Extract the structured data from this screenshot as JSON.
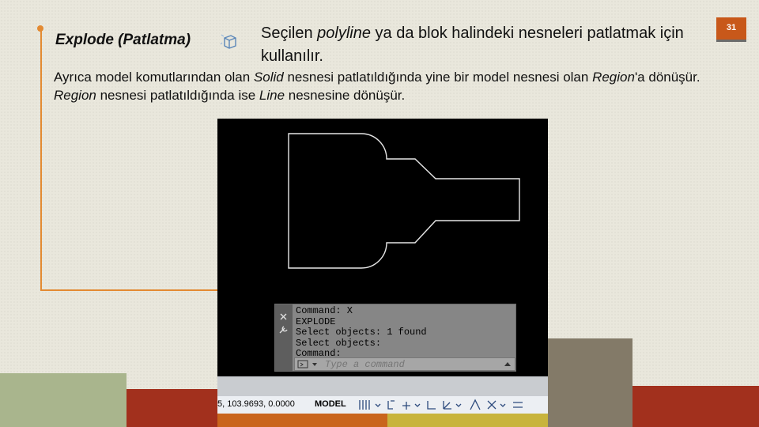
{
  "slide": {
    "page_number": "31",
    "title": "Explode (Patlatma)",
    "description_before": "Seçilen ",
    "description_italic": "polyline",
    "description_after": " ya da blok halindeki nesneleri patlatmak için kullanılır.",
    "body": [
      {
        "t": "Ayrıca model komutlarından olan ",
        "i": false
      },
      {
        "t": "Solid",
        "i": true
      },
      {
        "t": " nesnesi patlatıldığında yine bir model nesnesi olan ",
        "i": false
      },
      {
        "t": "Region",
        "i": true
      },
      {
        "t": "'a dönüşür. ",
        "i": false
      },
      {
        "t": "Region",
        "i": true
      },
      {
        "t": " nesnesi patlatıldığında ise ",
        "i": false
      },
      {
        "t": "Line",
        "i": true
      },
      {
        "t": " nesnesine dönüşür.",
        "i": false
      }
    ]
  },
  "cad": {
    "command_history": [
      "Command: X",
      "EXPLODE",
      "Select objects: 1 found",
      "Select objects:",
      "Command:"
    ],
    "command_placeholder": "Type a command",
    "coordinates": "5, 103.9693, 0.0000",
    "mode": "MODEL"
  },
  "icons": {
    "title_icon": "explode-icon",
    "close": "close-icon",
    "customize": "wrench-icon",
    "prompt": "command-prompt-icon"
  },
  "colors": {
    "accent_orange": "#e38a32",
    "badge": "#c8581a",
    "canvas": "#000000"
  }
}
